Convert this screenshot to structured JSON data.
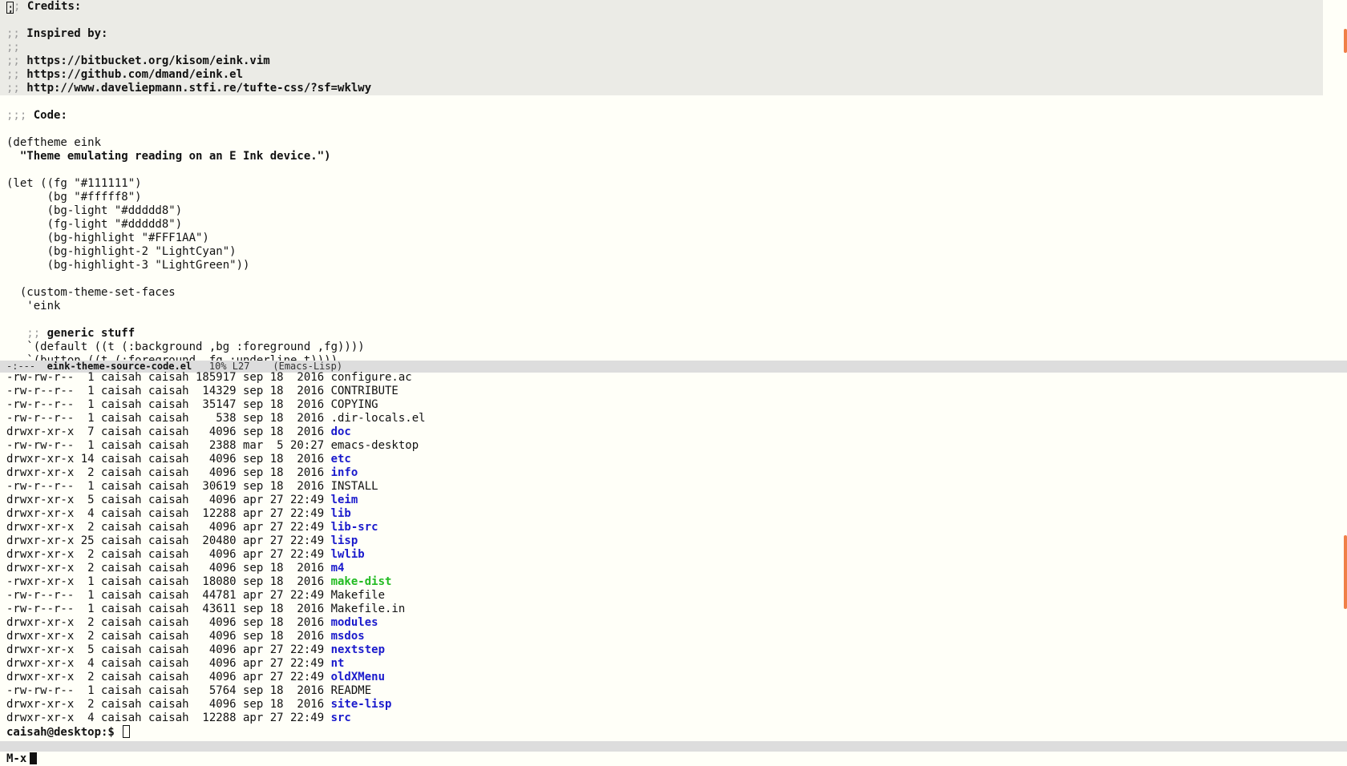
{
  "editor": {
    "credits_lines": [
      {
        "cursor": true,
        "prefix": ";;",
        "text": " Credits:"
      },
      {
        "prefix": "",
        "text": ""
      },
      {
        "prefix": ";;",
        "text": " Inspired by:"
      },
      {
        "prefix": ";;",
        "text": ""
      },
      {
        "prefix": ";;",
        "text": " https://bitbucket.org/kisom/eink.vim"
      },
      {
        "prefix": ";;",
        "text": " https://github.com/dmand/eink.el"
      },
      {
        "prefix": ";;",
        "text": " http://www.daveliepmann.stfi.re/tufte-css/?sf=wklwy"
      }
    ],
    "code_lines": [
      {
        "prefix": "",
        "text": ""
      },
      {
        "prefix": ";;;",
        "text": " Code:",
        "bold": true
      },
      {
        "prefix": "",
        "text": ""
      },
      {
        "prefix": "",
        "text": "(deftheme eink"
      },
      {
        "prefix": "",
        "text": "  \"Theme emulating reading on an E Ink device.\")",
        "bold": true
      },
      {
        "prefix": "",
        "text": ""
      },
      {
        "prefix": "",
        "text": "(let ((fg \"#111111\")"
      },
      {
        "prefix": "",
        "text": "      (bg \"#fffff8\")"
      },
      {
        "prefix": "",
        "text": "      (bg-light \"#ddddd8\")"
      },
      {
        "prefix": "",
        "text": "      (fg-light \"#ddddd8\")"
      },
      {
        "prefix": "",
        "text": "      (bg-highlight \"#FFF1AA\")"
      },
      {
        "prefix": "",
        "text": "      (bg-highlight-2 \"LightCyan\")"
      },
      {
        "prefix": "",
        "text": "      (bg-highlight-3 \"LightGreen\"))"
      },
      {
        "prefix": "",
        "text": ""
      },
      {
        "prefix": "",
        "text": "  (custom-theme-set-faces"
      },
      {
        "prefix": "",
        "text": "   'eink"
      },
      {
        "prefix": "",
        "text": ""
      },
      {
        "prefix": "   ;;",
        "text": " generic stuff",
        "bold": true
      },
      {
        "prefix": "",
        "text": "   `(default ((t (:background ,bg :foreground ,fg))))"
      },
      {
        "prefix": "",
        "text": "   `(button ((t (:foreground ,fg :underline t))))"
      }
    ]
  },
  "mode_line": {
    "status": "-:---",
    "buffer_name": "eink-theme-source-code.el",
    "position": "10% L27",
    "mode": "(Emacs-Lisp)"
  },
  "shell": {
    "entries": [
      {
        "perms": "-rw-rw-r--",
        "links": " 1",
        "owner": "caisah",
        "group": "caisah",
        "size": "185917",
        "month": "sep",
        "day": "18",
        "time": " 2016",
        "name": "configure.ac",
        "type": "file"
      },
      {
        "perms": "-rw-r--r--",
        "links": " 1",
        "owner": "caisah",
        "group": "caisah",
        "size": " 14329",
        "month": "sep",
        "day": "18",
        "time": " 2016",
        "name": "CONTRIBUTE",
        "type": "file"
      },
      {
        "perms": "-rw-r--r--",
        "links": " 1",
        "owner": "caisah",
        "group": "caisah",
        "size": " 35147",
        "month": "sep",
        "day": "18",
        "time": " 2016",
        "name": "COPYING",
        "type": "file"
      },
      {
        "perms": "-rw-r--r--",
        "links": " 1",
        "owner": "caisah",
        "group": "caisah",
        "size": "   538",
        "month": "sep",
        "day": "18",
        "time": " 2016",
        "name": ".dir-locals.el",
        "type": "file"
      },
      {
        "perms": "drwxr-xr-x",
        "links": " 7",
        "owner": "caisah",
        "group": "caisah",
        "size": "  4096",
        "month": "sep",
        "day": "18",
        "time": " 2016",
        "name": "doc",
        "type": "dir"
      },
      {
        "perms": "-rw-rw-r--",
        "links": " 1",
        "owner": "caisah",
        "group": "caisah",
        "size": "  2388",
        "month": "mar",
        "day": " 5",
        "time": "20:27",
        "name": "emacs-desktop",
        "type": "file"
      },
      {
        "perms": "drwxr-xr-x",
        "links": "14",
        "owner": "caisah",
        "group": "caisah",
        "size": "  4096",
        "month": "sep",
        "day": "18",
        "time": " 2016",
        "name": "etc",
        "type": "dir"
      },
      {
        "perms": "drwxr-xr-x",
        "links": " 2",
        "owner": "caisah",
        "group": "caisah",
        "size": "  4096",
        "month": "sep",
        "day": "18",
        "time": " 2016",
        "name": "info",
        "type": "dir"
      },
      {
        "perms": "-rw-r--r--",
        "links": " 1",
        "owner": "caisah",
        "group": "caisah",
        "size": " 30619",
        "month": "sep",
        "day": "18",
        "time": " 2016",
        "name": "INSTALL",
        "type": "file"
      },
      {
        "perms": "drwxr-xr-x",
        "links": " 5",
        "owner": "caisah",
        "group": "caisah",
        "size": "  4096",
        "month": "apr",
        "day": "27",
        "time": "22:49",
        "name": "leim",
        "type": "dir"
      },
      {
        "perms": "drwxr-xr-x",
        "links": " 4",
        "owner": "caisah",
        "group": "caisah",
        "size": " 12288",
        "month": "apr",
        "day": "27",
        "time": "22:49",
        "name": "lib",
        "type": "dir"
      },
      {
        "perms": "drwxr-xr-x",
        "links": " 2",
        "owner": "caisah",
        "group": "caisah",
        "size": "  4096",
        "month": "apr",
        "day": "27",
        "time": "22:49",
        "name": "lib-src",
        "type": "dir"
      },
      {
        "perms": "drwxr-xr-x",
        "links": "25",
        "owner": "caisah",
        "group": "caisah",
        "size": " 20480",
        "month": "apr",
        "day": "27",
        "time": "22:49",
        "name": "lisp",
        "type": "dir"
      },
      {
        "perms": "drwxr-xr-x",
        "links": " 2",
        "owner": "caisah",
        "group": "caisah",
        "size": "  4096",
        "month": "apr",
        "day": "27",
        "time": "22:49",
        "name": "lwlib",
        "type": "dir"
      },
      {
        "perms": "drwxr-xr-x",
        "links": " 2",
        "owner": "caisah",
        "group": "caisah",
        "size": "  4096",
        "month": "sep",
        "day": "18",
        "time": " 2016",
        "name": "m4",
        "type": "dir"
      },
      {
        "perms": "-rwxr-xr-x",
        "links": " 1",
        "owner": "caisah",
        "group": "caisah",
        "size": " 18080",
        "month": "sep",
        "day": "18",
        "time": " 2016",
        "name": "make-dist",
        "type": "exe"
      },
      {
        "perms": "-rw-r--r--",
        "links": " 1",
        "owner": "caisah",
        "group": "caisah",
        "size": " 44781",
        "month": "apr",
        "day": "27",
        "time": "22:49",
        "name": "Makefile",
        "type": "file"
      },
      {
        "perms": "-rw-r--r--",
        "links": " 1",
        "owner": "caisah",
        "group": "caisah",
        "size": " 43611",
        "month": "sep",
        "day": "18",
        "time": " 2016",
        "name": "Makefile.in",
        "type": "file"
      },
      {
        "perms": "drwxr-xr-x",
        "links": " 2",
        "owner": "caisah",
        "group": "caisah",
        "size": "  4096",
        "month": "sep",
        "day": "18",
        "time": " 2016",
        "name": "modules",
        "type": "dir"
      },
      {
        "perms": "drwxr-xr-x",
        "links": " 2",
        "owner": "caisah",
        "group": "caisah",
        "size": "  4096",
        "month": "sep",
        "day": "18",
        "time": " 2016",
        "name": "msdos",
        "type": "dir"
      },
      {
        "perms": "drwxr-xr-x",
        "links": " 5",
        "owner": "caisah",
        "group": "caisah",
        "size": "  4096",
        "month": "apr",
        "day": "27",
        "time": "22:49",
        "name": "nextstep",
        "type": "dir"
      },
      {
        "perms": "drwxr-xr-x",
        "links": " 4",
        "owner": "caisah",
        "group": "caisah",
        "size": "  4096",
        "month": "apr",
        "day": "27",
        "time": "22:49",
        "name": "nt",
        "type": "dir"
      },
      {
        "perms": "drwxr-xr-x",
        "links": " 2",
        "owner": "caisah",
        "group": "caisah",
        "size": "  4096",
        "month": "apr",
        "day": "27",
        "time": "22:49",
        "name": "oldXMenu",
        "type": "dir"
      },
      {
        "perms": "-rw-rw-r--",
        "links": " 1",
        "owner": "caisah",
        "group": "caisah",
        "size": "  5764",
        "month": "sep",
        "day": "18",
        "time": " 2016",
        "name": "README",
        "type": "file"
      },
      {
        "perms": "drwxr-xr-x",
        "links": " 2",
        "owner": "caisah",
        "group": "caisah",
        "size": "  4096",
        "month": "sep",
        "day": "18",
        "time": " 2016",
        "name": "site-lisp",
        "type": "dir"
      },
      {
        "perms": "drwxr-xr-x",
        "links": " 4",
        "owner": "caisah",
        "group": "caisah",
        "size": " 12288",
        "month": "apr",
        "day": "27",
        "time": "22:49",
        "name": "src",
        "type": "dir"
      }
    ],
    "prompt": "caisah@desktop:$"
  },
  "minibuffer": {
    "text": "M-x"
  },
  "colors": {
    "background": "#fffff8",
    "foreground": "#111111",
    "highlight_region": "#ebebe6",
    "mode_line": "#dddddd",
    "directory": "#1a1acc",
    "executable": "#22bb22",
    "scroll_indicator": "#f08048"
  }
}
